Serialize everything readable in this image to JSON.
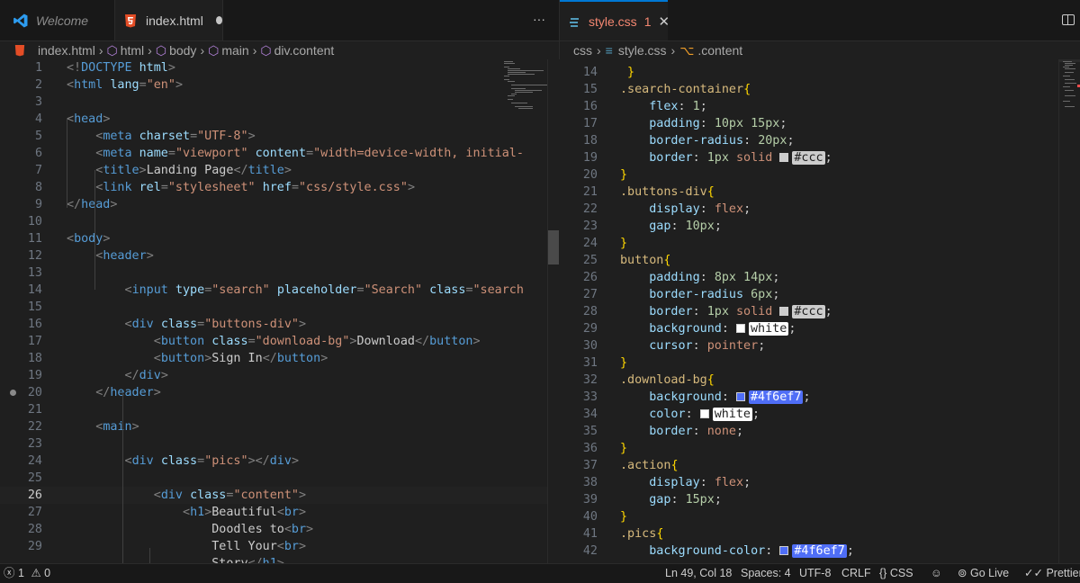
{
  "tabs": {
    "left": [
      {
        "label": "Welcome",
        "icon": "vscode-logo-icon"
      },
      {
        "label": "index.html",
        "icon": "html-file-icon",
        "modified": true
      }
    ],
    "right": [
      {
        "label": "style.css",
        "icon": "css-file-icon",
        "problems": "1"
      }
    ],
    "more_label": "···"
  },
  "breadcrumbs": {
    "left": [
      "index.html",
      "html",
      "body",
      "main",
      "div.content"
    ],
    "right": [
      "css",
      "style.css",
      ".content"
    ]
  },
  "html_editor": {
    "current_line": 26,
    "lines": [
      {
        "n": "1",
        "code": [
          [
            "p",
            "<!"
          ],
          [
            "k",
            "DOCTYPE "
          ],
          [
            "a",
            "html"
          ],
          [
            "p",
            ">"
          ]
        ]
      },
      {
        "n": "2",
        "code": [
          [
            "p",
            "<"
          ],
          [
            "k",
            "html "
          ],
          [
            "a",
            "lang"
          ],
          [
            "p",
            "="
          ],
          [
            "s",
            "\"en\""
          ],
          [
            "p",
            ">"
          ]
        ]
      },
      {
        "n": "3",
        "code": []
      },
      {
        "n": "4",
        "code": [
          [
            "p",
            "<"
          ],
          [
            "k",
            "head"
          ],
          [
            "p",
            ">"
          ]
        ]
      },
      {
        "n": "5",
        "code": [
          [
            "t",
            "    "
          ],
          [
            "p",
            "<"
          ],
          [
            "k",
            "meta "
          ],
          [
            "a",
            "charset"
          ],
          [
            "p",
            "="
          ],
          [
            "s",
            "\"UTF-8\""
          ],
          [
            "p",
            ">"
          ]
        ]
      },
      {
        "n": "6",
        "code": [
          [
            "t",
            "    "
          ],
          [
            "p",
            "<"
          ],
          [
            "k",
            "meta "
          ],
          [
            "a",
            "name"
          ],
          [
            "p",
            "="
          ],
          [
            "s",
            "\"viewport\" "
          ],
          [
            "a",
            "content"
          ],
          [
            "p",
            "="
          ],
          [
            "s",
            "\"width=device-width, initial-"
          ]
        ]
      },
      {
        "n": "7",
        "code": [
          [
            "t",
            "    "
          ],
          [
            "p",
            "<"
          ],
          [
            "k",
            "title"
          ],
          [
            "p",
            ">"
          ],
          [
            "t",
            "Landing Page"
          ],
          [
            "p",
            "</"
          ],
          [
            "k",
            "title"
          ],
          [
            "p",
            ">"
          ]
        ]
      },
      {
        "n": "8",
        "code": [
          [
            "t",
            "    "
          ],
          [
            "p",
            "<"
          ],
          [
            "k",
            "link "
          ],
          [
            "a",
            "rel"
          ],
          [
            "p",
            "="
          ],
          [
            "s",
            "\"stylesheet\" "
          ],
          [
            "a",
            "href"
          ],
          [
            "p",
            "="
          ],
          [
            "s",
            "\"css/style.css\""
          ],
          [
            "p",
            ">"
          ]
        ]
      },
      {
        "n": "9",
        "code": [
          [
            "p",
            "</"
          ],
          [
            "k",
            "head"
          ],
          [
            "p",
            ">"
          ]
        ]
      },
      {
        "n": "10",
        "code": []
      },
      {
        "n": "11",
        "code": [
          [
            "p",
            "<"
          ],
          [
            "k",
            "body"
          ],
          [
            "p",
            ">"
          ]
        ]
      },
      {
        "n": "12",
        "code": [
          [
            "t",
            "    "
          ],
          [
            "p",
            "<"
          ],
          [
            "k",
            "header"
          ],
          [
            "p",
            ">"
          ]
        ]
      },
      {
        "n": "13",
        "code": []
      },
      {
        "n": "14",
        "code": [
          [
            "t",
            "        "
          ],
          [
            "p",
            "<"
          ],
          [
            "k",
            "input "
          ],
          [
            "a",
            "type"
          ],
          [
            "p",
            "="
          ],
          [
            "s",
            "\"search\" "
          ],
          [
            "a",
            "placeholder"
          ],
          [
            "p",
            "="
          ],
          [
            "s",
            "\"Search\" "
          ],
          [
            "a",
            "class"
          ],
          [
            "p",
            "="
          ],
          [
            "s",
            "\"search"
          ]
        ]
      },
      {
        "n": "15",
        "code": []
      },
      {
        "n": "16",
        "code": [
          [
            "t",
            "        "
          ],
          [
            "p",
            "<"
          ],
          [
            "k",
            "div "
          ],
          [
            "a",
            "class"
          ],
          [
            "p",
            "="
          ],
          [
            "s",
            "\"buttons-div\""
          ],
          [
            "p",
            ">"
          ]
        ]
      },
      {
        "n": "17",
        "code": [
          [
            "t",
            "            "
          ],
          [
            "p",
            "<"
          ],
          [
            "k",
            "button "
          ],
          [
            "a",
            "class"
          ],
          [
            "p",
            "="
          ],
          [
            "s",
            "\"download-bg\""
          ],
          [
            "p",
            ">"
          ],
          [
            "t",
            "Download"
          ],
          [
            "p",
            "</"
          ],
          [
            "k",
            "button"
          ],
          [
            "p",
            ">"
          ]
        ]
      },
      {
        "n": "18",
        "code": [
          [
            "t",
            "            "
          ],
          [
            "p",
            "<"
          ],
          [
            "k",
            "button"
          ],
          [
            "p",
            ">"
          ],
          [
            "t",
            "Sign In"
          ],
          [
            "p",
            "</"
          ],
          [
            "k",
            "button"
          ],
          [
            "p",
            ">"
          ]
        ]
      },
      {
        "n": "19",
        "code": [
          [
            "t",
            "        "
          ],
          [
            "p",
            "</"
          ],
          [
            "k",
            "div"
          ],
          [
            "p",
            ">"
          ]
        ]
      },
      {
        "n": "20",
        "code": [
          [
            "t",
            "    "
          ],
          [
            "p",
            "</"
          ],
          [
            "k",
            "header"
          ],
          [
            "p",
            ">"
          ]
        ]
      },
      {
        "n": "21",
        "code": []
      },
      {
        "n": "22",
        "code": [
          [
            "t",
            "    "
          ],
          [
            "p",
            "<"
          ],
          [
            "k",
            "main"
          ],
          [
            "p",
            ">"
          ]
        ]
      },
      {
        "n": "23",
        "code": []
      },
      {
        "n": "24",
        "code": [
          [
            "t",
            "        "
          ],
          [
            "p",
            "<"
          ],
          [
            "k",
            "div "
          ],
          [
            "a",
            "class"
          ],
          [
            "p",
            "="
          ],
          [
            "s",
            "\"pics\""
          ],
          [
            "p",
            "></"
          ],
          [
            "k",
            "div"
          ],
          [
            "p",
            ">"
          ]
        ]
      },
      {
        "n": "25",
        "code": []
      },
      {
        "n": "26",
        "code": [
          [
            "t",
            "            "
          ],
          [
            "p",
            "<"
          ],
          [
            "k",
            "div "
          ],
          [
            "a",
            "class"
          ],
          [
            "p",
            "="
          ],
          [
            "s",
            "\"content\""
          ],
          [
            "p",
            ">"
          ]
        ]
      },
      {
        "n": "27",
        "code": [
          [
            "t",
            "                "
          ],
          [
            "p",
            "<"
          ],
          [
            "k",
            "h1"
          ],
          [
            "p",
            ">"
          ],
          [
            "t",
            "Beautiful"
          ],
          [
            "p",
            "<"
          ],
          [
            "k",
            "br"
          ],
          [
            "p",
            ">"
          ]
        ]
      },
      {
        "n": "28",
        "code": [
          [
            "t",
            "                    Doodles to"
          ],
          [
            "p",
            "<"
          ],
          [
            "k",
            "br"
          ],
          [
            "p",
            ">"
          ]
        ]
      },
      {
        "n": "29",
        "code": [
          [
            "t",
            "                    Tell Your"
          ],
          [
            "p",
            "<"
          ],
          [
            "k",
            "br"
          ],
          [
            "p",
            ">"
          ]
        ]
      },
      {
        "n": "",
        "code": [
          [
            "t",
            "                    Story"
          ],
          [
            "p",
            "</"
          ],
          [
            "k",
            "h1"
          ],
          [
            "p",
            ">"
          ]
        ]
      }
    ]
  },
  "css_editor": {
    "lines": [
      {
        "n": "14",
        "code": [
          [
            "b",
            " }"
          ]
        ]
      },
      {
        "n": "15",
        "code": [
          [
            "sel",
            ".search-container"
          ],
          [
            "b",
            "{"
          ]
        ]
      },
      {
        "n": "16",
        "code": [
          [
            "t",
            "    "
          ],
          [
            "pr",
            "flex"
          ],
          [
            "t",
            ": "
          ],
          [
            "nu",
            "1"
          ],
          [
            "t",
            ";"
          ]
        ]
      },
      {
        "n": "17",
        "code": [
          [
            "t",
            "    "
          ],
          [
            "pr",
            "padding"
          ],
          [
            "t",
            ": "
          ],
          [
            "nu",
            "10px 15px"
          ],
          [
            "t",
            ";"
          ]
        ]
      },
      {
        "n": "18",
        "code": [
          [
            "t",
            "    "
          ],
          [
            "pr",
            "border-radius"
          ],
          [
            "t",
            ": "
          ],
          [
            "nu",
            "20px"
          ],
          [
            "t",
            ";"
          ]
        ]
      },
      {
        "n": "19",
        "code": [
          [
            "t",
            "    "
          ],
          [
            "pr",
            "border"
          ],
          [
            "t",
            ": "
          ],
          [
            "nu",
            "1px "
          ],
          [
            "v",
            "solid "
          ],
          [
            "c",
            "#ccc"
          ],
          [
            "t",
            ";"
          ]
        ]
      },
      {
        "n": "20",
        "code": [
          [
            "b",
            "}"
          ]
        ]
      },
      {
        "n": "21",
        "code": [
          [
            "sel",
            ".buttons-div"
          ],
          [
            "b",
            "{"
          ]
        ]
      },
      {
        "n": "22",
        "code": [
          [
            "t",
            "    "
          ],
          [
            "pr",
            "display"
          ],
          [
            "t",
            ": "
          ],
          [
            "v",
            "flex"
          ],
          [
            "t",
            ";"
          ]
        ]
      },
      {
        "n": "23",
        "code": [
          [
            "t",
            "    "
          ],
          [
            "pr",
            "gap"
          ],
          [
            "t",
            ": "
          ],
          [
            "nu",
            "10px"
          ],
          [
            "t",
            ";"
          ]
        ]
      },
      {
        "n": "24",
        "code": [
          [
            "b",
            "}"
          ]
        ]
      },
      {
        "n": "25",
        "code": [
          [
            "sel",
            "button"
          ],
          [
            "b",
            "{"
          ]
        ]
      },
      {
        "n": "26",
        "code": [
          [
            "t",
            "    "
          ],
          [
            "pr",
            "padding"
          ],
          [
            "t",
            ": "
          ],
          [
            "nu",
            "8px 14px"
          ],
          [
            "t",
            ";"
          ]
        ]
      },
      {
        "n": "27",
        "code": [
          [
            "t",
            "    "
          ],
          [
            "pr",
            "border-radius "
          ],
          [
            "nu",
            "6px"
          ],
          [
            "t",
            ";"
          ]
        ]
      },
      {
        "n": "28",
        "code": [
          [
            "t",
            "    "
          ],
          [
            "pr",
            "border"
          ],
          [
            "t",
            ": "
          ],
          [
            "nu",
            "1px "
          ],
          [
            "v",
            "solid "
          ],
          [
            "c",
            "#ccc"
          ],
          [
            "t",
            ";"
          ]
        ]
      },
      {
        "n": "29",
        "code": [
          [
            "t",
            "    "
          ],
          [
            "pr",
            "background"
          ],
          [
            "t",
            ": "
          ],
          [
            "c",
            "white"
          ],
          [
            "t",
            ";"
          ]
        ]
      },
      {
        "n": "30",
        "code": [
          [
            "t",
            "    "
          ],
          [
            "pr",
            "cursor"
          ],
          [
            "t",
            ": "
          ],
          [
            "v",
            "pointer"
          ],
          [
            "t",
            ";"
          ]
        ]
      },
      {
        "n": "31",
        "code": [
          [
            "b",
            "}"
          ]
        ]
      },
      {
        "n": "32",
        "code": [
          [
            "sel",
            ".download-bg"
          ],
          [
            "b",
            "{"
          ]
        ]
      },
      {
        "n": "33",
        "code": [
          [
            "t",
            "    "
          ],
          [
            "pr",
            "background"
          ],
          [
            "t",
            ": "
          ],
          [
            "c",
            "#4f6ef7"
          ],
          [
            "t",
            ";"
          ]
        ]
      },
      {
        "n": "34",
        "code": [
          [
            "t",
            "    "
          ],
          [
            "pr",
            "color"
          ],
          [
            "t",
            ": "
          ],
          [
            "c",
            "white"
          ],
          [
            "t",
            ";"
          ]
        ]
      },
      {
        "n": "35",
        "code": [
          [
            "t",
            "    "
          ],
          [
            "pr",
            "border"
          ],
          [
            "t",
            ": "
          ],
          [
            "v",
            "none"
          ],
          [
            "t",
            ";"
          ]
        ]
      },
      {
        "n": "36",
        "code": [
          [
            "b",
            "}"
          ]
        ]
      },
      {
        "n": "37",
        "code": [
          [
            "sel",
            ".action"
          ],
          [
            "b",
            "{"
          ]
        ]
      },
      {
        "n": "38",
        "code": [
          [
            "t",
            "    "
          ],
          [
            "pr",
            "display"
          ],
          [
            "t",
            ": "
          ],
          [
            "v",
            "flex"
          ],
          [
            "t",
            ";"
          ]
        ]
      },
      {
        "n": "39",
        "code": [
          [
            "t",
            "    "
          ],
          [
            "pr",
            "gap"
          ],
          [
            "t",
            ": "
          ],
          [
            "nu",
            "15px"
          ],
          [
            "t",
            ";"
          ]
        ]
      },
      {
        "n": "40",
        "code": [
          [
            "b",
            "}"
          ]
        ]
      },
      {
        "n": "41",
        "code": [
          [
            "sel",
            ".pics"
          ],
          [
            "b",
            "{"
          ]
        ]
      },
      {
        "n": "42",
        "code": [
          [
            "t",
            "    "
          ],
          [
            "pr",
            "background-color"
          ],
          [
            "t",
            ": "
          ],
          [
            "c",
            "#4f6ef7"
          ],
          [
            "t",
            ";"
          ]
        ]
      }
    ]
  },
  "colors": {
    "#ccc": "#cccccc",
    "white": "#ffffff",
    "#4f6ef7": "#4f6ef7"
  },
  "status": {
    "errors": "1",
    "warnings": "0",
    "position": "Ln 49, Col 18",
    "spaces": "Spaces: 4",
    "encoding": "UTF-8",
    "eol": "CRLF",
    "language": "CSS",
    "golive": "Go Live",
    "prettier": "Prettier"
  }
}
